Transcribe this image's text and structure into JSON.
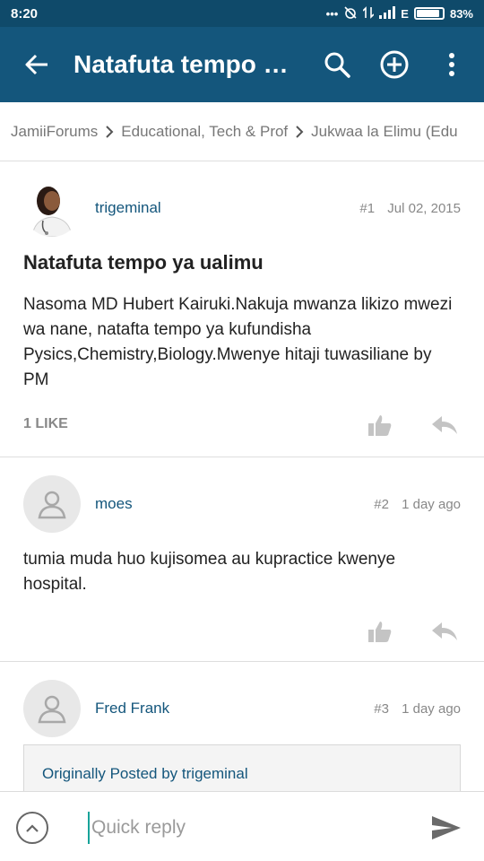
{
  "status_bar": {
    "time": "8:20",
    "network": "E",
    "battery": "83%",
    "battery_level": 0.83
  },
  "toolbar": {
    "title": "Natafuta tempo ya ualimu",
    "icons": [
      "back-arrow-icon",
      "search-icon",
      "add-circle-icon",
      "more-vert-icon"
    ]
  },
  "breadcrumb": [
    "JamiiForums",
    "Educational, Tech & Prof",
    "Jukwaa la Elimu (Edu"
  ],
  "posts": [
    {
      "username": "trigeminal",
      "number": "#1",
      "date": "Jul 02, 2015",
      "title": "Natafuta tempo ya ualimu",
      "body": "Nasoma MD Hubert Kairuki.Nakuja mwanza likizo mwezi wa nane, natafta tempo ya kufundisha Pysics,Chemistry,Biology.Mwenye hitaji tuwasiliane by PM",
      "likes": "1 LIKE"
    },
    {
      "username": "moes",
      "number": "#2",
      "date": "1 day ago",
      "body": "tumia muda huo kujisomea au kupractice kwenye hospital."
    },
    {
      "username": "Fred Frank",
      "number": "#3",
      "date": "1 day ago",
      "quote": "Originally Posted by trigeminal"
    }
  ],
  "reply": {
    "placeholder": "Quick reply"
  },
  "colors": {
    "status_bar": "#0f4a6a",
    "toolbar": "#14567c",
    "link": "#14567c",
    "cursor": "#17a39a"
  }
}
